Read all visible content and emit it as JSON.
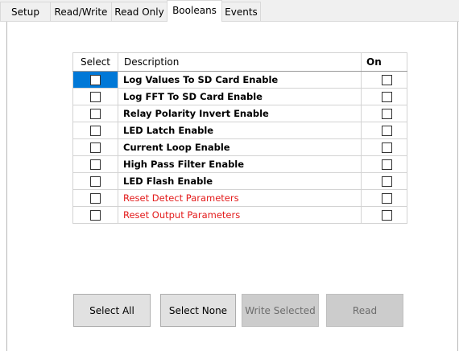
{
  "tabs": [
    {
      "label": "Setup"
    },
    {
      "label": "Read/Write"
    },
    {
      "label": "Read Only"
    },
    {
      "label": "Booleans"
    },
    {
      "label": "Events"
    }
  ],
  "active_tab": "Booleans",
  "table": {
    "columns": {
      "select": "Select",
      "description": "Description",
      "on": "On"
    },
    "rows": [
      {
        "description": "Log Values To SD Card Enable",
        "selected": false,
        "on": false,
        "highlighted": true,
        "warning": false
      },
      {
        "description": "Log FFT To SD Card Enable",
        "selected": false,
        "on": false,
        "highlighted": false,
        "warning": false
      },
      {
        "description": "Relay Polarity Invert Enable",
        "selected": false,
        "on": false,
        "highlighted": false,
        "warning": false
      },
      {
        "description": "LED Latch Enable",
        "selected": false,
        "on": false,
        "highlighted": false,
        "warning": false
      },
      {
        "description": "Current Loop Enable",
        "selected": false,
        "on": false,
        "highlighted": false,
        "warning": false
      },
      {
        "description": "High Pass Filter Enable",
        "selected": false,
        "on": false,
        "highlighted": false,
        "warning": false
      },
      {
        "description": "LED Flash Enable",
        "selected": false,
        "on": false,
        "highlighted": false,
        "warning": false
      },
      {
        "description": "Reset Detect Parameters",
        "selected": false,
        "on": false,
        "highlighted": false,
        "warning": true
      },
      {
        "description": "Reset Output Parameters",
        "selected": false,
        "on": false,
        "highlighted": false,
        "warning": true
      }
    ]
  },
  "buttons": {
    "select_all": {
      "label": "Select All",
      "enabled": true
    },
    "select_none": {
      "label": "Select None",
      "enabled": true
    },
    "write_selected": {
      "label": "Write Selected",
      "enabled": false
    },
    "read": {
      "label": "Read",
      "enabled": false
    }
  },
  "colors": {
    "selection_highlight": "#0078d7",
    "warning_text": "#e31b1b",
    "tab_background": "#f0f0f0"
  }
}
